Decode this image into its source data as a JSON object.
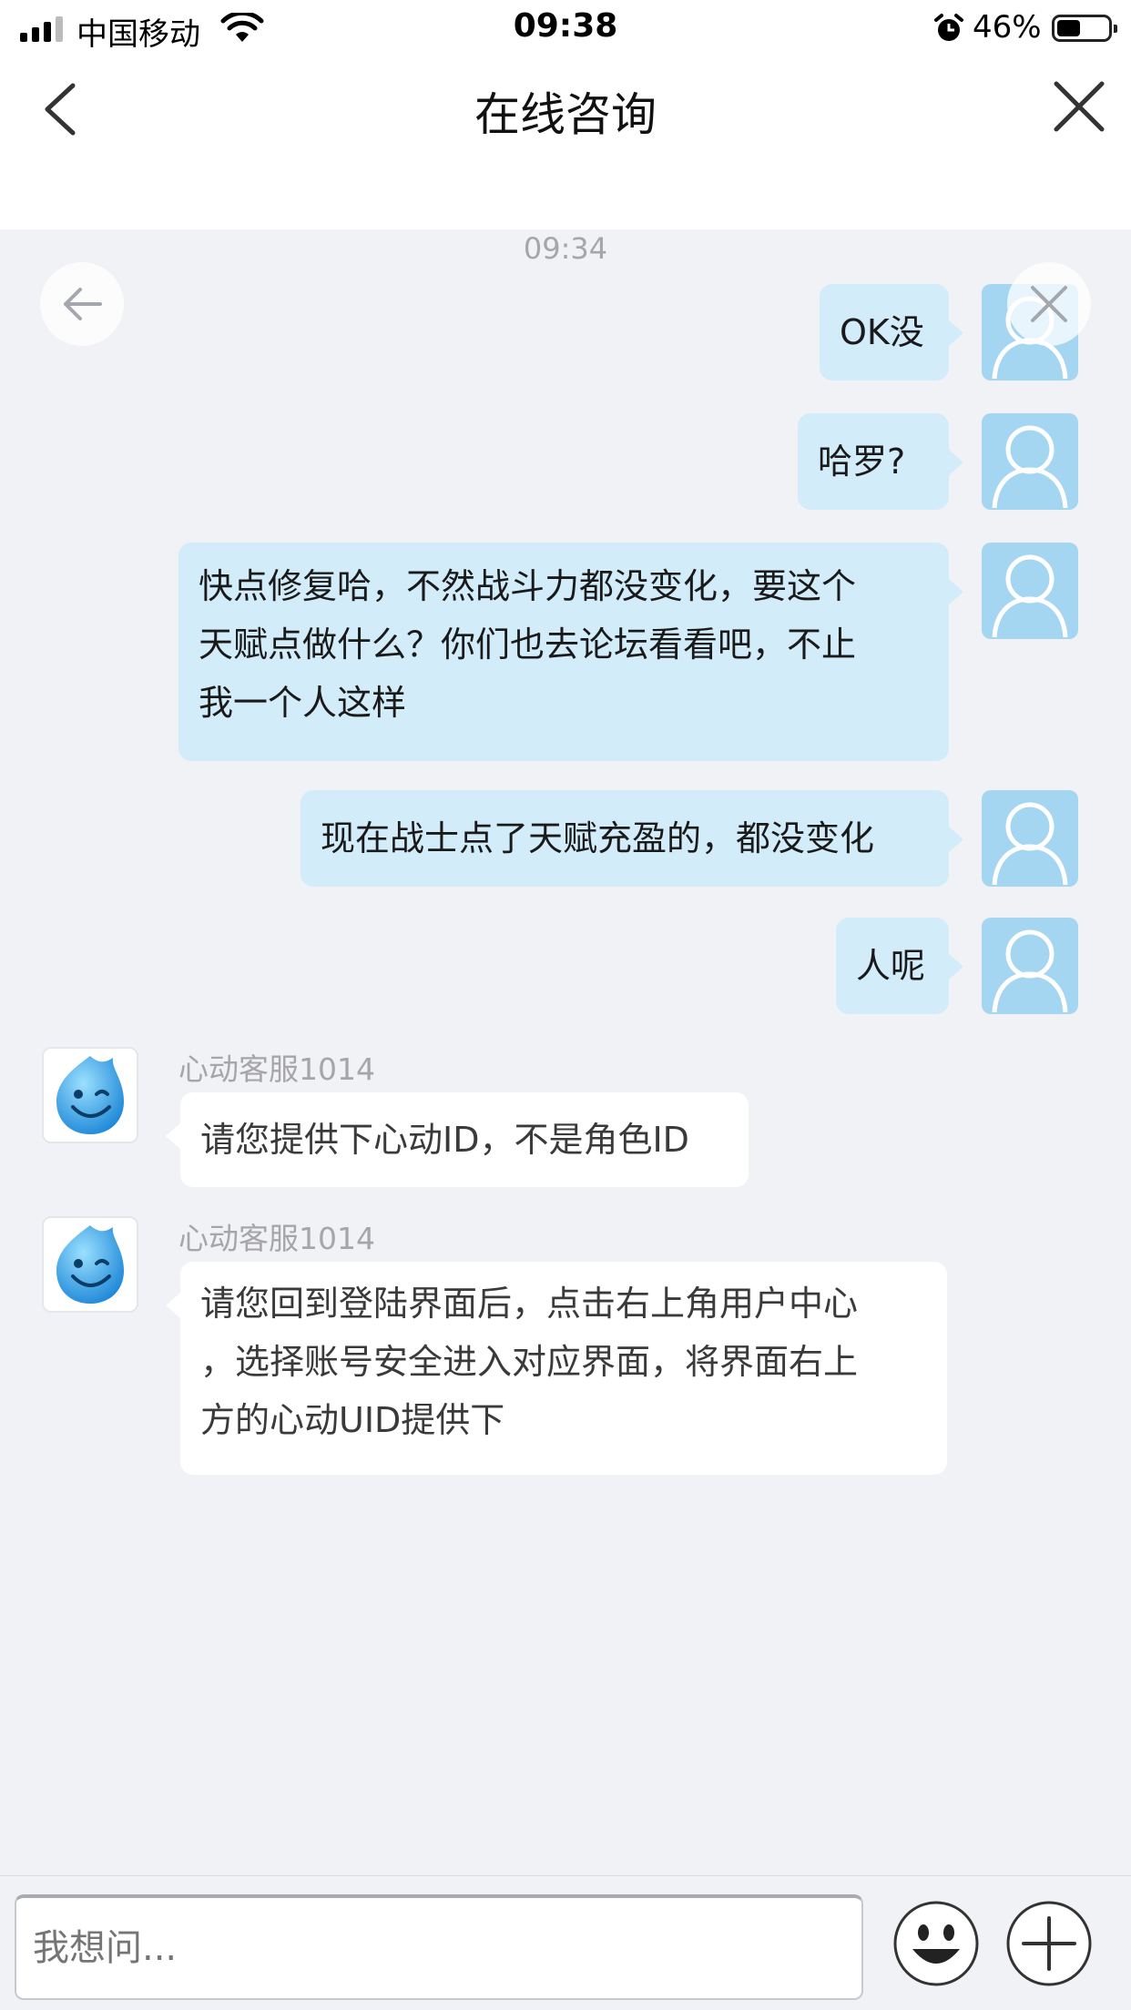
{
  "status_bar": {
    "carrier": "中国移动",
    "time": "09:38",
    "battery_percent": "46%",
    "battery_level": 0.46,
    "icons": [
      "signal-icon",
      "wifi-icon",
      "alarm-icon",
      "battery-icon"
    ]
  },
  "nav": {
    "title": "在线咨询",
    "back_icon": "chevron-left-icon",
    "close_icon": "close-icon"
  },
  "chat": {
    "timestamp": "09:34",
    "messages": [
      {
        "from": "user",
        "text": "OK没"
      },
      {
        "from": "user",
        "text": "哈罗?"
      },
      {
        "from": "user",
        "lines": [
          "快点修复哈，不然战斗力都没变化，要这个",
          "天赋点做什么？你们也去论坛看看吧，不止",
          "我一个人这样"
        ]
      },
      {
        "from": "user",
        "text": "现在战士点了天赋充盈的，都没变化"
      },
      {
        "from": "user",
        "text": "人呢"
      },
      {
        "from": "agent",
        "sender": "心动客服1014",
        "text": "请您提供下心动ID，不是角色ID"
      },
      {
        "from": "agent",
        "sender": "心动客服1014",
        "lines": [
          "请您回到登陆界面后，点击右上角用户中心",
          "，选择账号安全进入对应界面，将界面右上",
          "方的心动UID提供下"
        ]
      }
    ]
  },
  "input": {
    "placeholder": "我想问..."
  },
  "colors": {
    "chat_bg": "#f1f2f6",
    "user_bubble": "#d3ecfa",
    "user_avatar": "#a5d6f1",
    "agent_bubble": "#ffffff"
  }
}
